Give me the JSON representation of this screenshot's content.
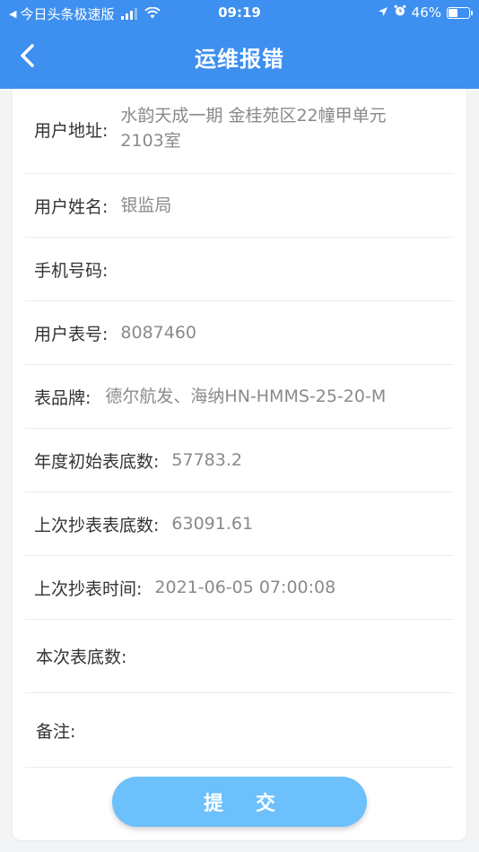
{
  "status_bar": {
    "back_app": "今日头条极速版",
    "time": "09:19",
    "battery": "46%",
    "battery_level": 0.46
  },
  "nav": {
    "title": "运维报错"
  },
  "form": {
    "address": {
      "label": "用户地址:",
      "value_line1": "水韵天成一期 金桂苑区22幢甲单元",
      "value_line2": "2103室"
    },
    "name": {
      "label": "用户姓名:",
      "value": "银监局"
    },
    "phone": {
      "label": "手机号码:",
      "value": ""
    },
    "meter_no": {
      "label": "用户表号:",
      "value": "8087460"
    },
    "brand": {
      "label": "表品牌:",
      "value": "德尔航发、海纳HN-HMMS-25-20-M"
    },
    "init_reading": {
      "label": "年度初始表底数:",
      "value": "57783.2"
    },
    "last_reading": {
      "label": "上次抄表表底数:",
      "value": "63091.61"
    },
    "last_time": {
      "label": "上次抄表时间:",
      "value": "2021-06-05 07:00:08"
    },
    "current_reading": {
      "label": "本次表底数:",
      "value": ""
    },
    "remark": {
      "label": "备注:",
      "value": ""
    }
  },
  "submit_label": "提交"
}
